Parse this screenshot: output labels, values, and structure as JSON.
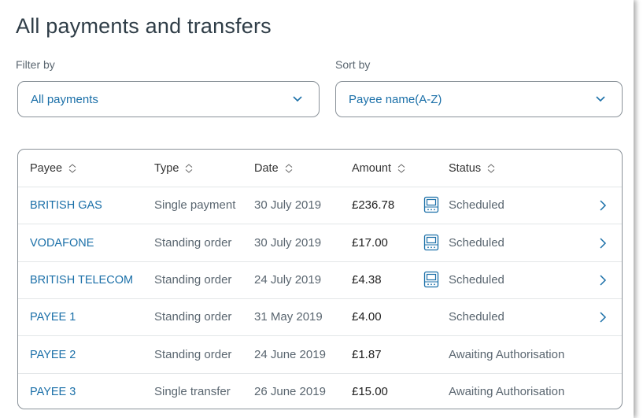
{
  "page": {
    "title": "All payments and transfers"
  },
  "filter": {
    "label": "Filter by",
    "value": "All payments"
  },
  "sort": {
    "label": "Sort by",
    "value": "Payee name(A-Z)"
  },
  "table": {
    "headers": [
      "Payee",
      "Type",
      "Date",
      "Amount",
      "Status"
    ],
    "rows": [
      {
        "payee": "BRITISH GAS",
        "type": "Single payment",
        "date": "30 July 2019",
        "amount": "£236.78",
        "status": "Scheduled",
        "icon": true,
        "arrow": true
      },
      {
        "payee": "VODAFONE",
        "type": "Standing order",
        "date": "30 July 2019",
        "amount": "£17.00",
        "status": "Scheduled",
        "icon": true,
        "arrow": true
      },
      {
        "payee": "BRITISH TELECOM",
        "type": "Standing order",
        "date": "24 July 2019",
        "amount": "£4.38",
        "status": "Scheduled",
        "icon": true,
        "arrow": true
      },
      {
        "payee": "PAYEE 1",
        "type": "Standing order",
        "date": "31 May 2019",
        "amount": "£4.00",
        "status": "Scheduled",
        "icon": false,
        "arrow": true
      },
      {
        "payee": "PAYEE 2",
        "type": "Standing order",
        "date": "24 June 2019",
        "amount": "£1.87",
        "status": "Awaiting Authorisation",
        "icon": false,
        "arrow": false
      },
      {
        "payee": "PAYEE 3",
        "type": "Single transfer",
        "date": "26 June 2019",
        "amount": "£15.00",
        "status": "Awaiting Authorisation",
        "icon": false,
        "arrow": false
      }
    ]
  },
  "icons": {
    "sort": "sort-updown-icon",
    "dropdown": "chevron-down-icon",
    "row_icon": "scheduled-calendar-icon",
    "row_arrow": "chevron-right-icon"
  },
  "colors": {
    "link": "#1a6fa8",
    "title": "#2f3d47",
    "border": "#8a9299"
  }
}
